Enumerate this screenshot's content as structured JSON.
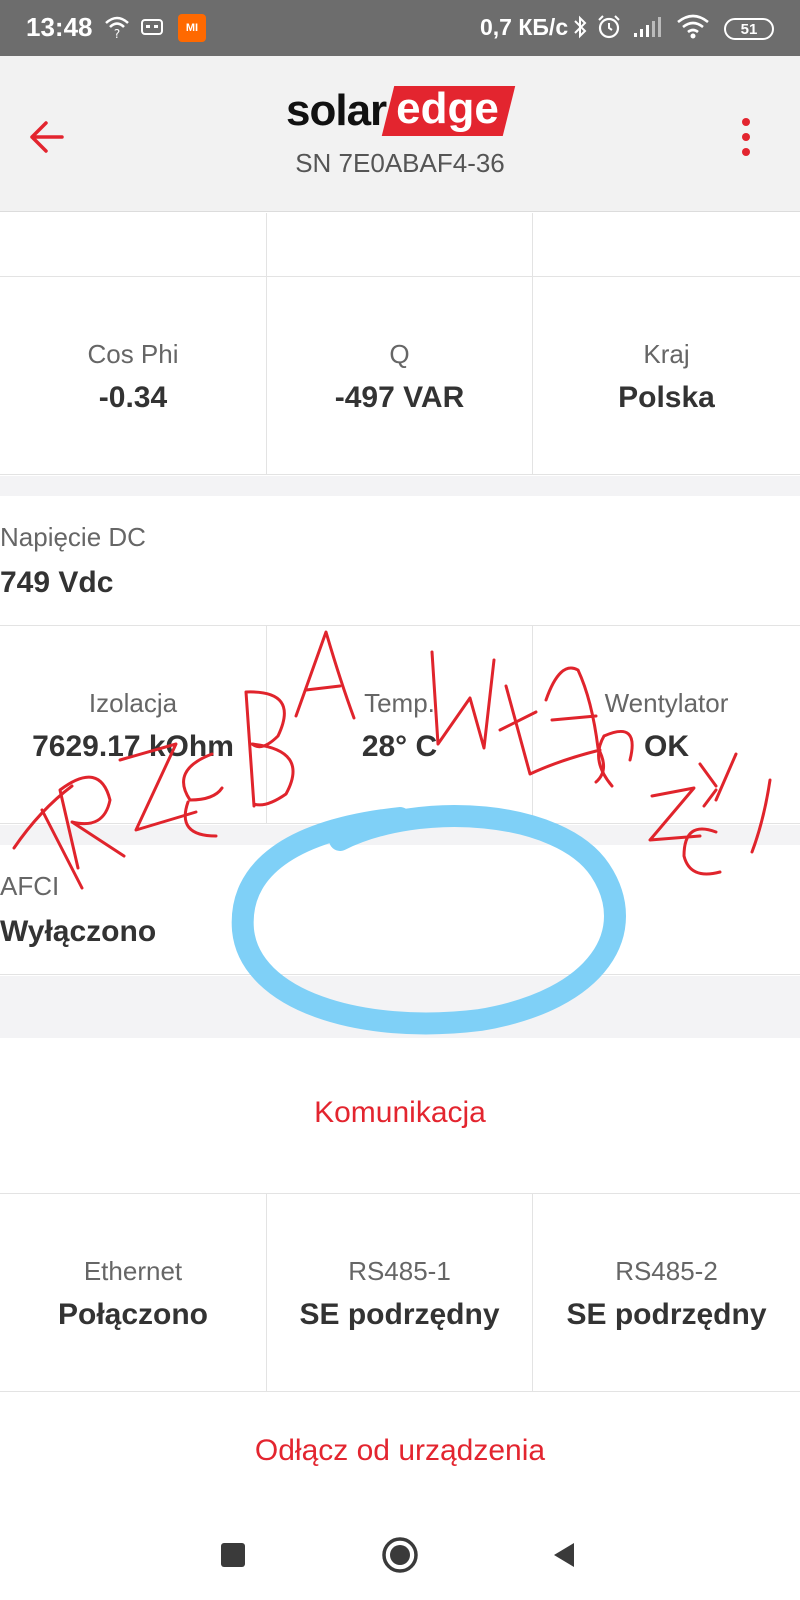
{
  "status_bar": {
    "time": "13:48",
    "network_speed": "0,7 КБ/с",
    "battery": "51",
    "mi_badge": "MI",
    "icons": [
      "wifi-question-icon",
      "vr-icon",
      "mi-app-icon",
      "bluetooth-icon",
      "alarm-icon",
      "signal-icon",
      "wifi-icon",
      "battery-icon"
    ]
  },
  "header": {
    "logo_left": "solar",
    "logo_right": "edge",
    "serial": "SN 7E0ABAF4-36",
    "brand_color": "#e3252f"
  },
  "grid": {
    "row1": [
      {
        "label": "Cos Phi",
        "value": "-0.34"
      },
      {
        "label": "Q",
        "value": "-497 VAR"
      },
      {
        "label": "Kraj",
        "value": "Polska"
      }
    ],
    "dc": {
      "label": "Napięcie DC",
      "value": "749 Vdc"
    },
    "row2": [
      {
        "label": "Izolacja",
        "value": "7629.17 kOhm"
      },
      {
        "label": "Temp.",
        "value": "28° C"
      },
      {
        "label": "Wentylator",
        "value": "OK"
      }
    ],
    "afci": {
      "label": "AFCI",
      "value": "Wyłączono"
    }
  },
  "communication": {
    "title": "Komunikacja",
    "items": [
      {
        "label": "Ethernet",
        "value": "Połączono"
      },
      {
        "label": "RS485-1",
        "value": "SE podrzędny"
      },
      {
        "label": "RS485-2",
        "value": "SE podrzędny"
      }
    ]
  },
  "disconnect_label": "Odłącz od urządzenia",
  "annotation": {
    "handwritten_text": "TRZEBA WŁĄCZYĆ",
    "ink_color": "#e0242c",
    "circle_color": "#7fd0f7"
  },
  "nav": [
    "recent-apps-icon",
    "home-icon",
    "back-icon"
  ]
}
